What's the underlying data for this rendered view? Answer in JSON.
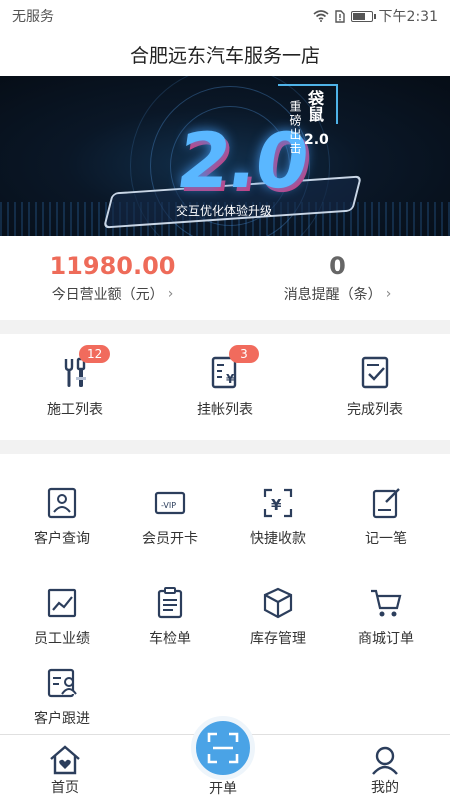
{
  "status": {
    "carrier": "无服务",
    "time": "下午2:31",
    "battery_level": 0.6
  },
  "header": {
    "title": "合肥远东汽车服务一店"
  },
  "banner": {
    "version": "2.0",
    "subtitle": "交互优化体验升级",
    "brand_name": "袋鼠",
    "brand_version": "2.0",
    "brand_slogan": "重磅出击"
  },
  "stats": [
    {
      "value": "11980.00",
      "label": "今日营业额（元）"
    },
    {
      "value": "0",
      "label": "消息提醒（条）"
    }
  ],
  "lists": [
    {
      "label": "施工列表",
      "badge": "12",
      "icon": "wrench-screwdriver-icon"
    },
    {
      "label": "挂帐列表",
      "badge": "3",
      "icon": "yuan-document-icon"
    },
    {
      "label": "完成列表",
      "icon": "checked-document-icon"
    }
  ],
  "functions": [
    {
      "label": "客户查询",
      "icon": "customer-card-icon"
    },
    {
      "label": "会员开卡",
      "icon": "vip-card-icon"
    },
    {
      "label": "快捷收款",
      "icon": "yuan-scan-icon"
    },
    {
      "label": "记一笔",
      "icon": "note-edit-icon"
    },
    {
      "label": "员工业绩",
      "icon": "trend-chart-icon"
    },
    {
      "label": "车检单",
      "icon": "clipboard-icon"
    },
    {
      "label": "库存管理",
      "icon": "box-icon"
    },
    {
      "label": "商城订单",
      "icon": "cart-icon"
    },
    {
      "label": "客户跟进",
      "icon": "customer-followup-icon"
    }
  ],
  "tabs": [
    {
      "label": "首页",
      "icon": "home-heart-icon"
    },
    {
      "label": "开单",
      "icon": "scan-icon"
    },
    {
      "label": "我的",
      "icon": "user-icon"
    }
  ],
  "colors": {
    "accent": "#4aa3e6",
    "revenue": "#ee6b59",
    "badge": "#f16b5d",
    "icon_stroke": "#2c3e5c"
  }
}
